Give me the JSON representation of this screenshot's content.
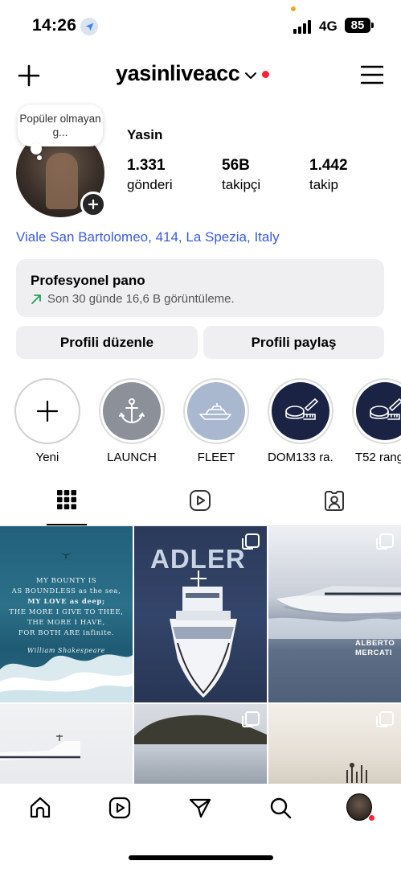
{
  "status_bar": {
    "time": "14:26",
    "network": "4G",
    "battery": "85"
  },
  "header": {
    "username": "yasinliveacc",
    "icons": [
      "plus-icon",
      "chevron-down-icon",
      "hamburger-menu-icon"
    ]
  },
  "profile": {
    "note": "Popüler olmayan g...",
    "display_name": "Yasin",
    "stats": [
      {
        "value": "1.331",
        "label": "gönderi"
      },
      {
        "value": "56B",
        "label": "takipçi"
      },
      {
        "value": "1.442",
        "label": "takip"
      }
    ],
    "location": "Viale San Bartolomeo, 414, La Spezia, Italy"
  },
  "pro_dashboard": {
    "title": "Profesyonel pano",
    "subtitle": "Son 30 günde 16,6 B görüntüleme."
  },
  "buttons": {
    "edit_profile": "Profili düzenle",
    "share_profile": "Profili paylaş"
  },
  "highlights": [
    {
      "label": "Yeni",
      "icon": "plus-icon"
    },
    {
      "label": "LAUNCH",
      "icon": "anchor-icon"
    },
    {
      "label": "FLEET",
      "icon": "yacht-icon"
    },
    {
      "label": "DOM133 ra...",
      "icon": "tape-measure-icon"
    },
    {
      "label": "T52 rang",
      "icon": "tape-measure-icon"
    }
  ],
  "posts": {
    "quote": {
      "line1": "MY BOUNTY IS",
      "line2": "AS BOUNDLESS as the sea,",
      "line3": "MY LOVE as deep;",
      "line4": "THE MORE I GIVE TO THEE,",
      "line5": "THE MORE I HAVE,",
      "line6": "FOR BOTH ARE infinite.",
      "author": "William Shakespeare"
    },
    "adler_title": "ADLER",
    "alberto_line1": "ALBERTO",
    "alberto_line2": "MERCATI"
  },
  "colors": {
    "accent_link": "#3b5bdb",
    "notification_red": "#ff1f3d",
    "trend_green": "#1ca35a",
    "panel_bg": "#efeff2"
  }
}
